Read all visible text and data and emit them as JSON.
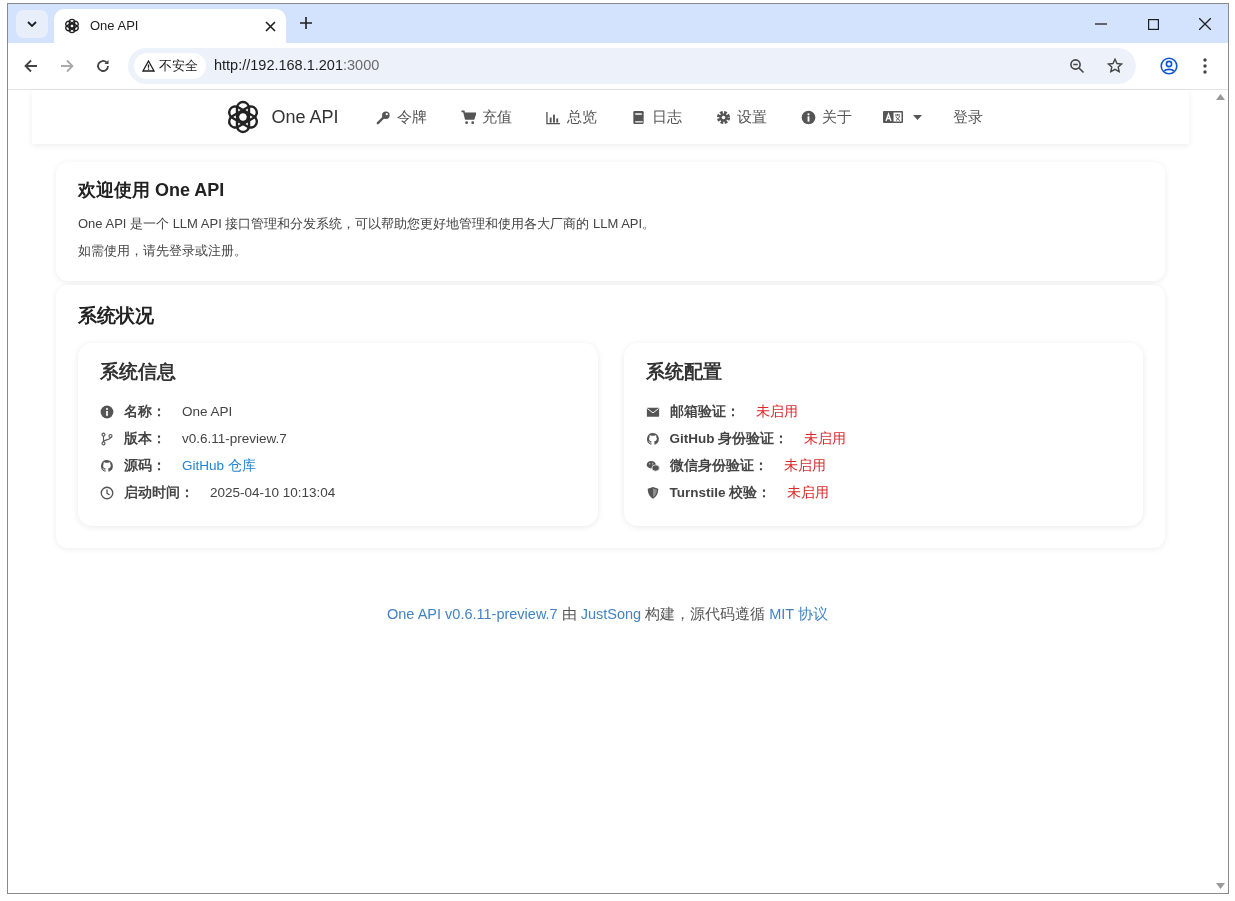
{
  "browser": {
    "tab_title": "One API",
    "security_label": "不安全",
    "url_host": "http://192.168.1.201",
    "url_port": ":3000"
  },
  "navbar": {
    "brand": "One API",
    "items": [
      {
        "label": "令牌"
      },
      {
        "label": "充值"
      },
      {
        "label": "总览"
      },
      {
        "label": "日志"
      },
      {
        "label": "设置"
      },
      {
        "label": "关于"
      }
    ],
    "login": "登录"
  },
  "welcome": {
    "title": "欢迎使用 One API",
    "paragraphs": [
      "One API 是一个 LLM API 接口管理和分发系统，可以帮助您更好地管理和使用各大厂商的 LLM API。",
      "如需使用，请先登录或注册。"
    ]
  },
  "status": {
    "title": "系统状况",
    "system_info": {
      "title": "系统信息",
      "rows": [
        {
          "label": "名称：",
          "value": "One API",
          "kind": "text"
        },
        {
          "label": "版本：",
          "value": "v0.6.11-preview.7",
          "kind": "text"
        },
        {
          "label": "源码：",
          "value": "GitHub 仓库",
          "kind": "link"
        },
        {
          "label": "启动时间：",
          "value": "2025-04-10 10:13:04",
          "kind": "text"
        }
      ]
    },
    "system_config": {
      "title": "系统配置",
      "rows": [
        {
          "label": "邮箱验证：",
          "value": "未启用",
          "enabled": false
        },
        {
          "label": "GitHub 身份验证：",
          "value": "未启用",
          "enabled": false
        },
        {
          "label": "微信身份验证：",
          "value": "未启用",
          "enabled": false
        },
        {
          "label": "Turnstile 校验：",
          "value": "未启用",
          "enabled": false
        }
      ]
    }
  },
  "footer": [
    {
      "kind": "link",
      "text": "One API v0.6.11-preview.7"
    },
    {
      "kind": "text",
      "text": "由"
    },
    {
      "kind": "link",
      "text": "JustSong"
    },
    {
      "kind": "text",
      "text": "构建，源代码遵循"
    },
    {
      "kind": "link",
      "text": "MIT 协议"
    }
  ]
}
